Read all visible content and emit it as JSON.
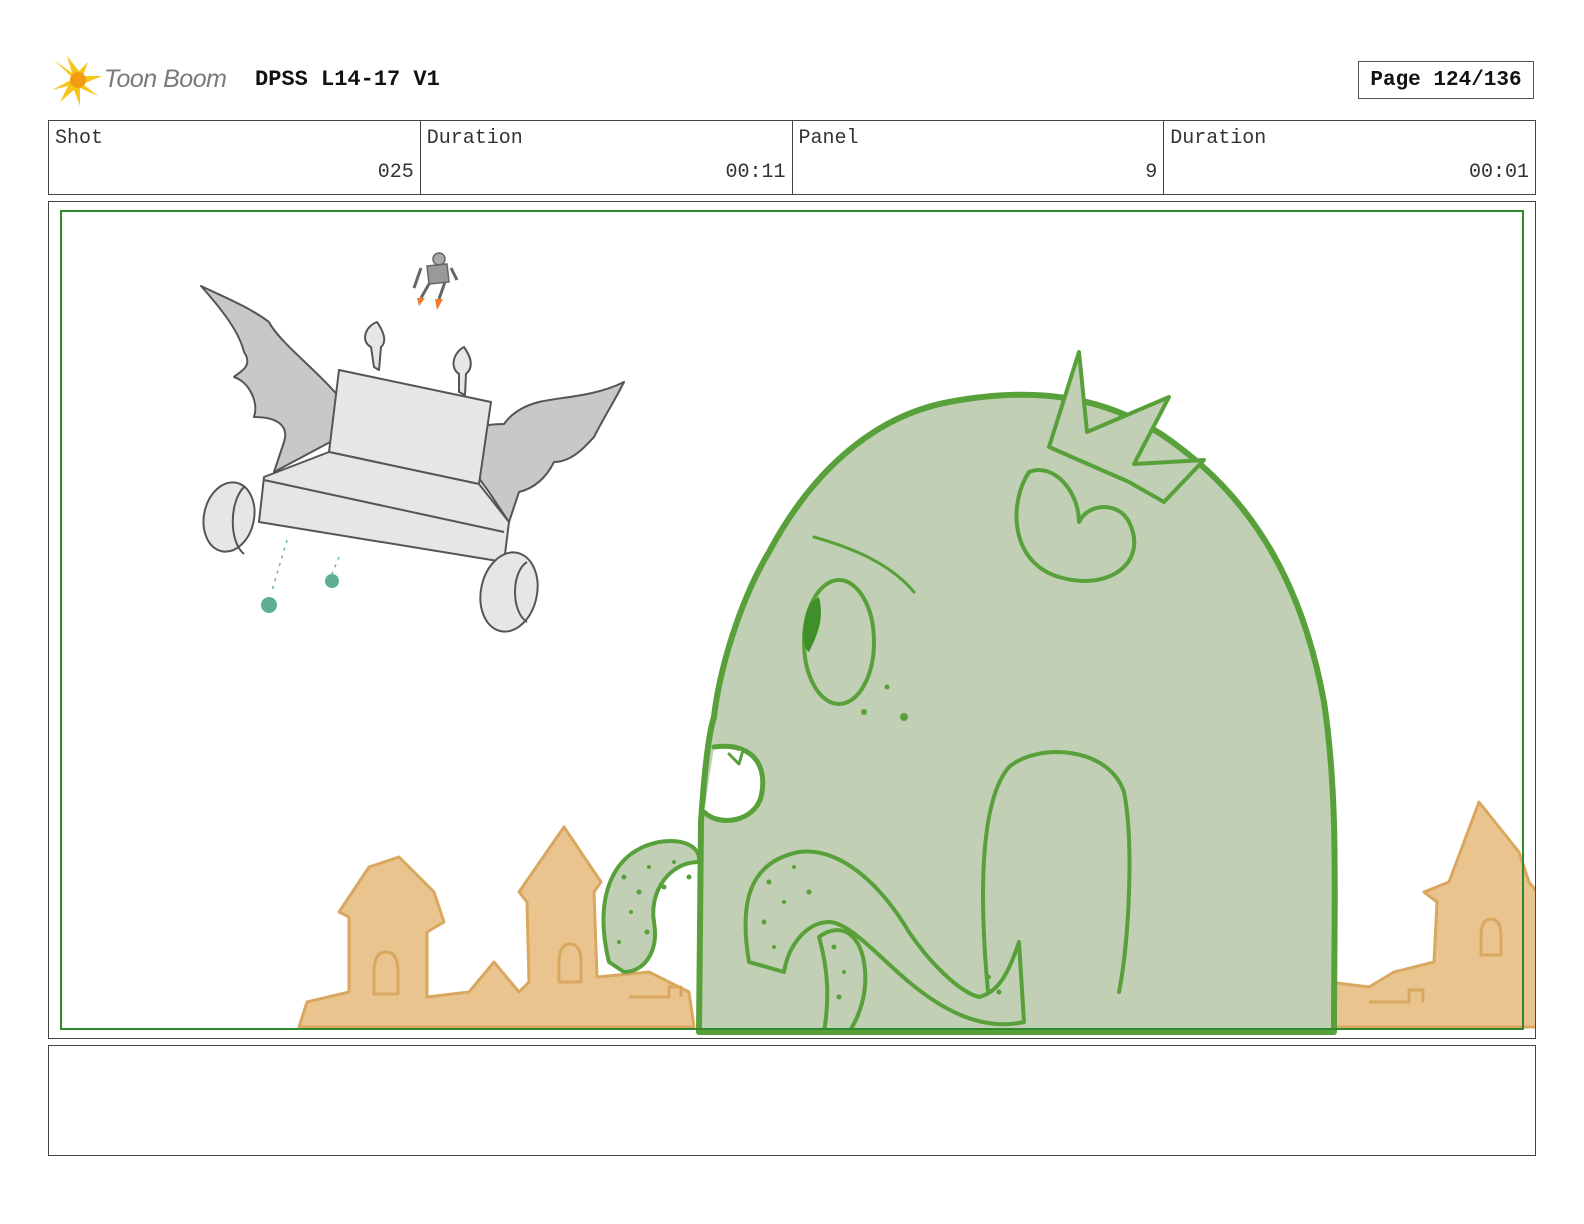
{
  "header": {
    "logo_text": "Toon Boom",
    "title": "DPSS L14-17 V1",
    "page": "Page 124/136"
  },
  "info": {
    "shot_label": "Shot",
    "shot_value": "025",
    "shot_duration_label": "Duration",
    "shot_duration_value": "00:11",
    "panel_label": "Panel",
    "panel_value": "9",
    "panel_duration_label": "Duration",
    "panel_duration_value": "00:01"
  },
  "notes": {
    "text": ""
  },
  "colors": {
    "monster_fill": "#c1cfb4",
    "monster_line": "#58a13a",
    "sand": "#e9c48f",
    "sand_line": "#d9a760",
    "cart": "#e6e6e6",
    "wing": "#c8c8c8",
    "frame": "#2f8a2f"
  }
}
